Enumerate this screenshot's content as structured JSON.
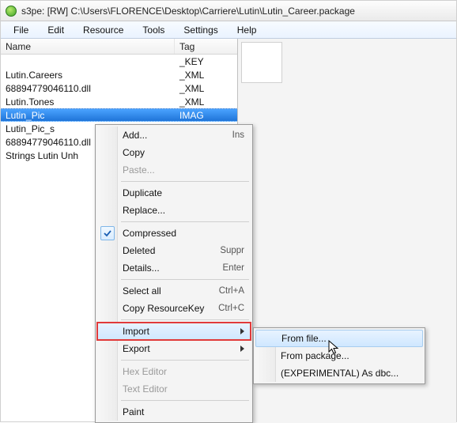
{
  "titlebar": {
    "title": "s3pe: [RW] C:\\Users\\FLORENCE\\Desktop\\Carriere\\Lutin\\Lutin_Career.package"
  },
  "menubar": {
    "items": [
      "File",
      "Edit",
      "Resource",
      "Tools",
      "Settings",
      "Help"
    ]
  },
  "list": {
    "headers": {
      "name": "Name",
      "tag": "Tag"
    },
    "rows": [
      {
        "name": "",
        "tag": "_KEY",
        "selected": false
      },
      {
        "name": "Lutin.Careers",
        "tag": "_XML",
        "selected": false
      },
      {
        "name": "68894779046110.dll",
        "tag": "_XML",
        "selected": false
      },
      {
        "name": "Lutin.Tones",
        "tag": "_XML",
        "selected": false
      },
      {
        "name": "Lutin_Pic",
        "tag": "IMAG",
        "selected": true
      },
      {
        "name": "Lutin_Pic_s",
        "tag": "",
        "selected": false
      },
      {
        "name": "68894779046110.dll",
        "tag": "",
        "selected": false
      },
      {
        "name": "Strings Lutin Unh",
        "tag": "",
        "selected": false
      }
    ]
  },
  "context_menu": {
    "items": [
      {
        "label": "Add...",
        "shortcut": "Ins",
        "enabled": true
      },
      {
        "label": "Copy",
        "enabled": true
      },
      {
        "label": "Paste...",
        "enabled": false
      },
      {
        "sep": true
      },
      {
        "label": "Duplicate",
        "enabled": true
      },
      {
        "label": "Replace...",
        "enabled": true
      },
      {
        "sep": true
      },
      {
        "label": "Compressed",
        "enabled": true,
        "checked": true
      },
      {
        "label": "Deleted",
        "shortcut": "Suppr",
        "enabled": true
      },
      {
        "label": "Details...",
        "shortcut": "Enter",
        "enabled": true
      },
      {
        "sep": true
      },
      {
        "label": "Select all",
        "shortcut": "Ctrl+A",
        "enabled": true
      },
      {
        "label": "Copy ResourceKey",
        "shortcut": "Ctrl+C",
        "enabled": true
      },
      {
        "sep": true
      },
      {
        "label": "Import",
        "enabled": true,
        "submenu": true,
        "highlighted": true
      },
      {
        "label": "Export",
        "enabled": true,
        "submenu": true
      },
      {
        "sep": true
      },
      {
        "label": "Hex Editor",
        "enabled": false
      },
      {
        "label": "Text Editor",
        "enabled": false
      },
      {
        "sep": true
      },
      {
        "label": "Paint",
        "enabled": true
      }
    ]
  },
  "submenu": {
    "items": [
      {
        "label": "From file...",
        "highlighted": true
      },
      {
        "label": "From package...",
        "highlighted": false
      },
      {
        "label": "(EXPERIMENTAL) As dbc...",
        "highlighted": false
      }
    ]
  }
}
